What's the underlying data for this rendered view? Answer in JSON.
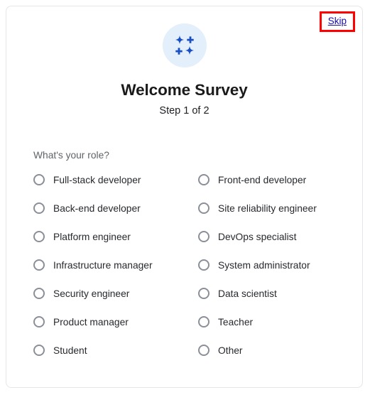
{
  "card": {
    "skip_label": "Skip",
    "title": "Welcome Survey",
    "step_text": "Step 1 of 2",
    "logo_icon": "sparkles-icon",
    "question_label": "What's your role?",
    "colors": {
      "logo_background": "#e3effb",
      "logo_glyph": "#1a4fc4",
      "skip_link": "#1a0dab",
      "highlight_box": "#ff0000",
      "question_label": "#5f6368",
      "option_label": "#27292d",
      "radio_border": "#8a8f98",
      "card_border": "#e4e6e8"
    }
  },
  "options": {
    "left": [
      {
        "label": "Full-stack developer",
        "selected": false
      },
      {
        "label": "Back-end developer",
        "selected": false
      },
      {
        "label": "Platform engineer",
        "selected": false
      },
      {
        "label": "Infrastructure manager",
        "selected": false
      },
      {
        "label": "Security engineer",
        "selected": false
      },
      {
        "label": "Product manager",
        "selected": false
      },
      {
        "label": "Student",
        "selected": false
      }
    ],
    "right": [
      {
        "label": "Front-end developer",
        "selected": false
      },
      {
        "label": "Site reliability engineer",
        "selected": false
      },
      {
        "label": "DevOps specialist",
        "selected": false
      },
      {
        "label": "System administrator",
        "selected": false
      },
      {
        "label": "Data scientist",
        "selected": false
      },
      {
        "label": "Teacher",
        "selected": false
      },
      {
        "label": "Other",
        "selected": false
      }
    ]
  }
}
